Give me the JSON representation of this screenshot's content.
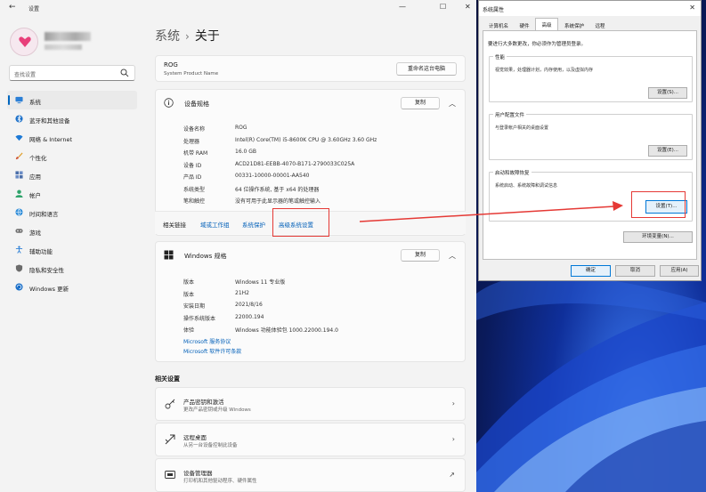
{
  "settings": {
    "window_title": "设置",
    "search_placeholder": "查找设置",
    "nav": [
      {
        "label": "系统",
        "icon": "monitor-icon",
        "active": true
      },
      {
        "label": "蓝牙和其他设备",
        "icon": "bluetooth-icon"
      },
      {
        "label": "网络 & Internet",
        "icon": "wifi-icon"
      },
      {
        "label": "个性化",
        "icon": "brush-icon"
      },
      {
        "label": "应用",
        "icon": "apps-icon"
      },
      {
        "label": "帐户",
        "icon": "account-icon"
      },
      {
        "label": "时间和语言",
        "icon": "globe-clock-icon"
      },
      {
        "label": "游戏",
        "icon": "gamepad-icon"
      },
      {
        "label": "辅助功能",
        "icon": "accessibility-icon"
      },
      {
        "label": "隐私和安全性",
        "icon": "shield-icon"
      },
      {
        "label": "Windows 更新",
        "icon": "update-icon"
      }
    ],
    "breadcrumb": {
      "parent": "系统",
      "sep": "›",
      "current": "关于"
    },
    "pc": {
      "name": "ROG",
      "model": "System Product Name",
      "rename_label": "重命名这台电脑"
    },
    "device_spec": {
      "title": "设备规格",
      "copy_label": "复制",
      "rows": [
        {
          "k": "设备名称",
          "v": "ROG"
        },
        {
          "k": "处理器",
          "v": "Intel(R) Core(TM) i5-8600K CPU @ 3.60GHz   3.60 GHz"
        },
        {
          "k": "机带 RAM",
          "v": "16.0 GB"
        },
        {
          "k": "设备 ID",
          "v": "ACD21D81-EEBB-4070-B171-2790033C025A"
        },
        {
          "k": "产品 ID",
          "v": "00331-10000-00001-AA540"
        },
        {
          "k": "系统类型",
          "v": "64 位操作系统, 基于 x64 的处理器"
        },
        {
          "k": "笔和触控",
          "v": "没有可用于此显示器的笔或触控输入"
        }
      ]
    },
    "related_links": {
      "label": "相关链接",
      "links": [
        "域或工作组",
        "系统保护",
        "高级系统设置"
      ]
    },
    "windows_spec": {
      "title": "Windows 规格",
      "copy_label": "复制",
      "rows": [
        {
          "k": "版本",
          "v": "Windows 11 专业版"
        },
        {
          "k": "版本",
          "v": "21H2"
        },
        {
          "k": "安装日期",
          "v": "2021/8/16"
        },
        {
          "k": "操作系统版本",
          "v": "22000.194"
        },
        {
          "k": "体验",
          "v": "Windows 功能体验包 1000.22000.194.0"
        }
      ],
      "links": [
        "Microsoft 服务协议",
        "Microsoft 软件许可条款"
      ]
    },
    "related_settings": {
      "title": "相关设置",
      "items": [
        {
          "t1": "产品密钥和激活",
          "t2": "更改产品密钥或升级 Windows",
          "icon": "key-icon",
          "arrow": "›"
        },
        {
          "t1": "远程桌面",
          "t2": "从另一台设备控制此设备",
          "icon": "remote-icon",
          "arrow": "›"
        },
        {
          "t1": "设备管理器",
          "t2": "打印机和其他驱动程序、硬件属性",
          "icon": "device-manager-icon",
          "arrow": "↗"
        }
      ]
    }
  },
  "dialog": {
    "title": "系统属性",
    "tabs": [
      "计算机名",
      "硬件",
      "高级",
      "系统保护",
      "远程"
    ],
    "active_tab": "高级",
    "note": "要进行大多数更改，你必须作为管理员登录。",
    "groups": [
      {
        "title": "性能",
        "desc": "视觉效果，处理器计划，内存使用，以及虚拟内存",
        "button": "设置(S)..."
      },
      {
        "title": "用户配置文件",
        "desc": "与登录帐户相关的桌面设置",
        "button": "设置(E)..."
      },
      {
        "title": "启动和故障恢复",
        "desc": "系统启动、系统故障和调试信息",
        "button": "设置(T)..."
      }
    ],
    "env_button": "环境变量(N)...",
    "ok": "确定",
    "cancel": "取消",
    "apply": "应用(A)"
  },
  "colors": {
    "accent": "#0067c0",
    "link": "#005fb8",
    "highlight": "#e53935"
  }
}
